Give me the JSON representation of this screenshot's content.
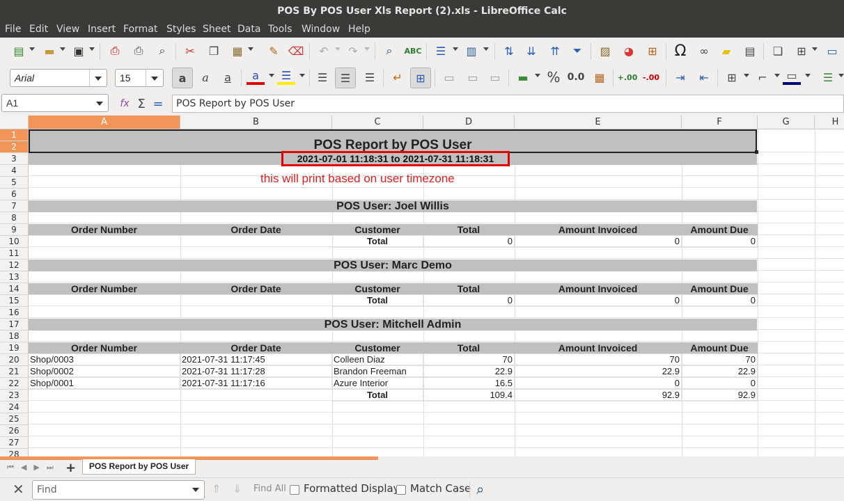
{
  "window": {
    "title": "POS By POS User Xls Report (2).xls - LibreOffice Calc"
  },
  "menu": [
    "File",
    "Edit",
    "View",
    "Insert",
    "Format",
    "Styles",
    "Sheet",
    "Data",
    "Tools",
    "Window",
    "Help"
  ],
  "font": {
    "name": "Arial",
    "size": "15"
  },
  "formula": {
    "cell_ref": "A1",
    "content": "POS Report by POS User"
  },
  "columns": [
    "A",
    "B",
    "C",
    "D",
    "E",
    "F",
    "G",
    "H"
  ],
  "rows": [
    "1",
    "2",
    "3",
    "4",
    "5",
    "6",
    "7",
    "8",
    "9",
    "10",
    "11",
    "12",
    "13",
    "14",
    "15",
    "16",
    "17",
    "18",
    "19",
    "20",
    "21",
    "22",
    "23",
    "24",
    "25",
    "26",
    "27",
    "28"
  ],
  "report": {
    "title": "POS Report by POS User",
    "date_range": "2021-07-01 11:18:31 to 2021-07-31 11:18:31",
    "note": "this will print based on user timezone",
    "headers": [
      "Order Number",
      "Order Date",
      "Customer",
      "Total",
      "Amount Invoiced",
      "Amount Due"
    ],
    "total_label": "Total",
    "sections": [
      {
        "user": "POS User: Joel Willis",
        "orders": [],
        "totals": [
          "0",
          "0",
          "0"
        ]
      },
      {
        "user": "POS User: Marc Demo",
        "orders": [],
        "totals": [
          "0",
          "0",
          "0"
        ]
      },
      {
        "user": "POS User: Mitchell Admin",
        "orders": [
          [
            "Shop/0003",
            "2021-07-31 11:17:45",
            "Colleen Diaz",
            "70",
            "70",
            "70"
          ],
          [
            "Shop/0002",
            "2021-07-31 11:17:28",
            "Brandon Freeman",
            "22.9",
            "22.9",
            "22.9"
          ],
          [
            "Shop/0001",
            "2021-07-31 11:17:16",
            "Azure Interior",
            "16.5",
            "0",
            "0"
          ]
        ],
        "totals": [
          "109.4",
          "92.9",
          "92.9"
        ]
      }
    ]
  },
  "sheet_tab": "POS Report by POS User",
  "find": {
    "placeholder": "Find",
    "find_all": "Find All",
    "formatted_display": "Formatted Display",
    "match_case": "Match Case"
  },
  "colors": {
    "header_band": "#c0c0c0",
    "selection": "#f19559",
    "note_red": "#e02020",
    "titlebar": "#3b3a36"
  }
}
